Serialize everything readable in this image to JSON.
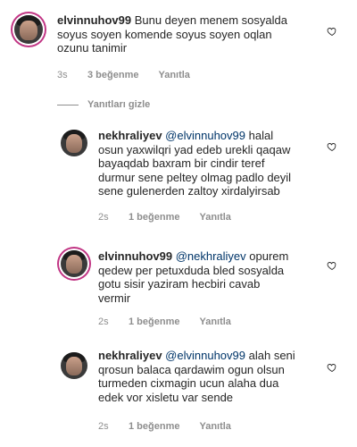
{
  "comments": [
    {
      "username": "elvinnuhov99",
      "mention": "",
      "text": "Bunu deyen menem sosyalda\nsoyus soyen komende soyus soyen oqlan\nozunu tanimir",
      "time": "3s",
      "likes": "3 beğenme",
      "reply": "Yanıtla"
    },
    {
      "username": "nekhraliyev",
      "mention": "@elvinnuhov99",
      "text": "halal\nosun yaxwilqri yad edeb urekli qaqaw\nbayaqdab baxram bir cindir teref\ndurmur sene peltey olmag padlo deyil\nsene gulenerden zaltoy xirdalyirsab",
      "time": "2s",
      "likes": "1 beğenme",
      "reply": "Yanıtla"
    },
    {
      "username": "elvinnuhov99",
      "mention": "@nekhraliyev",
      "text": "opurem\nqedew per petuxduda bled sosyalda\ngotu sisir yaziram hecbiri cavab\nvermir",
      "time": "2s",
      "likes": "1 beğenme",
      "reply": "Yanıtla"
    },
    {
      "username": "nekhraliyev",
      "mention": "@elvinnuhov99",
      "text": "alah seni\nqrosun balaca qardawim ogun olsun\nturmeden cixmagin ucun alaha dua\nedek vor xisletu var sende",
      "time": "2s",
      "likes": "1 beğenme",
      "reply": "Yanıtla"
    }
  ],
  "hide_replies_label": "Yanıtları gizle",
  "icons": {
    "like": "heart-outline-icon",
    "avatar": "user-avatar"
  },
  "colors": {
    "mention": "#003569",
    "meta": "#8e8e8e",
    "story_ring": "#c13584"
  }
}
